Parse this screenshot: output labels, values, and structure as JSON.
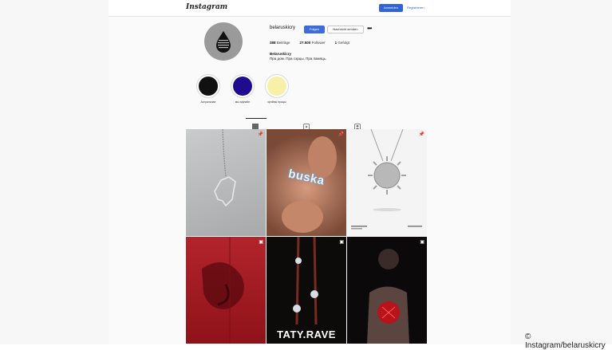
{
  "header": {
    "logo_text": "Instagram",
    "login_label": "Anmelden",
    "register_label": "Registrieren"
  },
  "profile": {
    "username": "belaruskicry",
    "follow_label": "Folgen",
    "message_label": "Nachricht senden",
    "more_icon": "more-horizontal-icon",
    "stats": {
      "posts_count": "388",
      "posts_label": "Beiträge",
      "followers_count": "27.500",
      "followers_label": "Follower",
      "following_count": "1",
      "following_label": "Gefolgt"
    },
    "bio_name": "Belaruskicry",
    "bio_text": "Пра дом. Пра сэрцы. Пра памяць."
  },
  "highlights": [
    {
      "label": "Актуальнае",
      "color": "#111111"
    },
    {
      "label": "мы афлайн",
      "color": "#1f0b8f"
    },
    {
      "label": "крэйны працы",
      "color": "#f6f0a8"
    }
  ],
  "tabs": [
    {
      "name": "grid-icon"
    },
    {
      "name": "reels-icon"
    },
    {
      "name": "tagged-icon"
    }
  ],
  "posts": [
    {
      "caption": "",
      "icon": "pin-icon"
    },
    {
      "caption": "buska",
      "icon": "pin-icon"
    },
    {
      "caption": "",
      "icon": "pin-icon"
    },
    {
      "caption": "",
      "icon": "image-icon"
    },
    {
      "caption": "",
      "icon": "image-icon"
    },
    {
      "caption": "",
      "icon": "image-icon"
    }
  ],
  "post6_caption": "TATY.RAVE",
  "credit": "© Instagram/belaruskicry"
}
